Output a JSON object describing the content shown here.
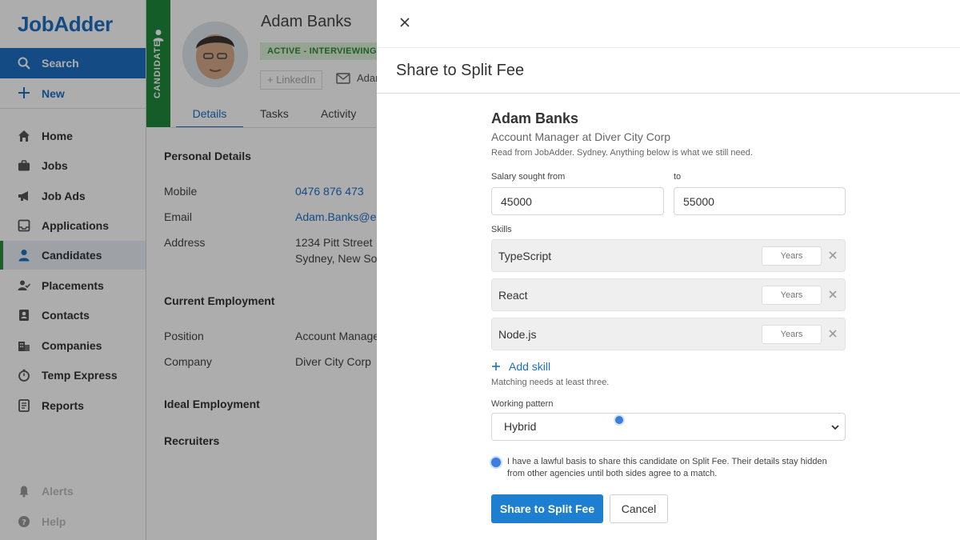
{
  "app": {
    "logo": "JobAdder"
  },
  "sidebar": {
    "search_label": "Search",
    "new_label": "New",
    "items": [
      {
        "label": "Home",
        "icon": "home-icon"
      },
      {
        "label": "Jobs",
        "icon": "briefcase-icon"
      },
      {
        "label": "Job Ads",
        "icon": "megaphone-icon"
      },
      {
        "label": "Applications",
        "icon": "inbox-icon"
      },
      {
        "label": "Candidates",
        "icon": "person-icon",
        "active": true
      },
      {
        "label": "Placements",
        "icon": "placement-icon"
      },
      {
        "label": "Contacts",
        "icon": "contact-icon"
      },
      {
        "label": "Companies",
        "icon": "building-icon"
      },
      {
        "label": "Temp Express",
        "icon": "stopwatch-icon"
      },
      {
        "label": "Reports",
        "icon": "report-icon"
      }
    ],
    "footer": [
      {
        "label": "Alerts",
        "icon": "bell-icon"
      },
      {
        "label": "Help",
        "icon": "help-icon"
      }
    ]
  },
  "candidate": {
    "strip_label": "CANDIDATE",
    "name": "Adam Banks",
    "status": "ACTIVE - INTERVIEWING",
    "linkedin_label": "+ LinkedIn",
    "email_short": "Adam",
    "tabs": [
      "Details",
      "Tasks",
      "Activity"
    ],
    "personal_title": "Personal Details",
    "mobile_label": "Mobile",
    "mobile": "0476 876 473",
    "email_label": "Email",
    "email": "Adam.Banks@em",
    "address_label": "Address",
    "address_line1": "1234 Pitt Street",
    "address_line2": "Sydney, New Sou",
    "employment_title": "Current Employment",
    "position_label": "Position",
    "position": "Account Manage",
    "company_label": "Company",
    "company": "Diver City Corp",
    "ideal_title": "Ideal Employment",
    "recruiters_title": "Recruiters"
  },
  "panel": {
    "title": "Share to Split Fee",
    "name": "Adam Banks",
    "subtitle": "Account Manager at Diver City Corp",
    "note": "Read from JobAdder. Sydney. Anything below is what we still need.",
    "salary_from_label": "Salary sought from",
    "salary_from": "45000",
    "salary_to_label": "to",
    "salary_to": "55000",
    "skills_label": "Skills",
    "skills": [
      {
        "name": "TypeScript",
        "years_placeholder": "Years"
      },
      {
        "name": "React",
        "years_placeholder": "Years"
      },
      {
        "name": "Node.js",
        "years_placeholder": "Years"
      }
    ],
    "add_skill_label": "Add skill",
    "skills_hint": "Matching needs at least three.",
    "working_pattern_label": "Working pattern",
    "working_pattern": "Hybrid",
    "consent_text": "I have a lawful basis to share this candidate on Split Fee. Their details stay hidden from other agencies until both sides agree to a match.",
    "submit_label": "Share to Split Fee",
    "cancel_label": "Cancel"
  },
  "colors": {
    "brand": "#1e6fc4",
    "candidate_green": "#1f8a3b",
    "primary_button": "#1e7fd0"
  }
}
